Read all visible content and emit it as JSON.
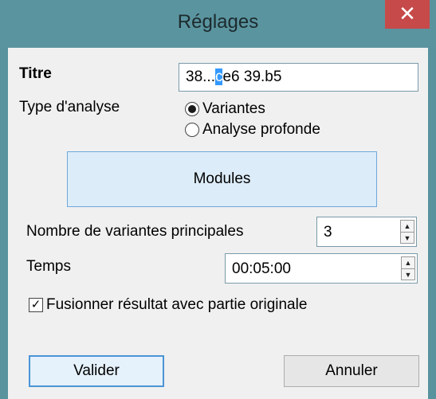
{
  "window": {
    "title": "Réglages",
    "close_glyph": "✕"
  },
  "form": {
    "title_label": "Titre",
    "title_value_before": "38...",
    "title_value_selected": "c",
    "title_value_after": "e6 39.b5",
    "analysis_type_label": "Type d'analyse",
    "analysis_options": [
      "Variantes",
      "Analyse profonde"
    ],
    "analysis_selected": "Variantes",
    "modules_label": "Modules",
    "main_variants_label": "Nombre de variantes principales",
    "main_variants_value": "3",
    "time_label": "Temps",
    "time_value": "00:05:00",
    "merge_label": "Fusionner résultat avec partie originale",
    "merge_checked": true
  },
  "buttons": {
    "ok": "Valider",
    "cancel": "Annuler"
  },
  "icons": {
    "close": "close-icon",
    "checkmark": "checkmark-icon",
    "spin_up": "▲",
    "spin_down": "▼"
  },
  "colors": {
    "titlebar": "#5a949f",
    "close": "#c64a4a",
    "modules_bg": "#dcecf8"
  }
}
